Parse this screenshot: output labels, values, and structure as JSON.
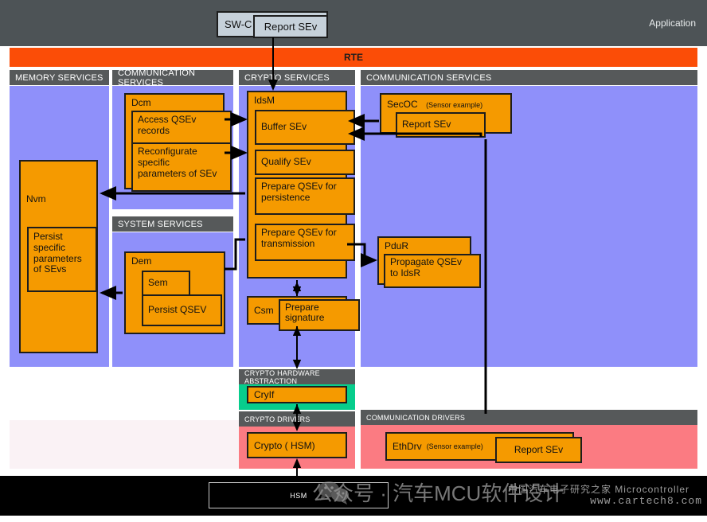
{
  "application": {
    "label": "Application",
    "swc": {
      "name": "SW-C",
      "action": "Report   SEv"
    }
  },
  "rte": {
    "label": "RTE"
  },
  "layers": {
    "memory_services": "MEMORY SERVICES",
    "communication_services_left": "COMMUNICATION SERVICES",
    "crypto_services": "CRYPTO SERVICES",
    "communication_services_right": "COMMUNICATION SERVICES",
    "system_services": "SYSTEM SERVICES",
    "crypto_hardware_abstraction": "CRYPTO  HARDWARE ABSTRACTION",
    "crypto_drivers": "CRYPTO  DRIVERS",
    "communication_drivers": "COMMUNICATION DRIVERS"
  },
  "modules": {
    "nvm": {
      "title": "Nvm",
      "items": [
        "Persist\nspecific\nparameters\nof  SEvs"
      ]
    },
    "dcm": {
      "title": "Dcm",
      "items": [
        "Access   QSEv\nrecords",
        "Reconfigurate\nspecific\nparameters of     SEv"
      ]
    },
    "dem": {
      "title": "Dem",
      "items": [
        "Sem",
        "Persist   QSEV"
      ]
    },
    "idsm": {
      "title": "IdsM",
      "items": [
        "Buffer   SEv",
        "Qualify    SEv",
        "Prepare   QSEv for\npersistence",
        "Prepare   QSEv for\ntransmission"
      ]
    },
    "csm": {
      "title": "Csm",
      "items": [
        "Prepare\nsignature"
      ]
    },
    "secoc": {
      "title": "SecOC",
      "note": "(Sensor example)",
      "items": [
        "Report   SEv"
      ]
    },
    "pdur": {
      "title": "PduR",
      "items": [
        "Propagate    QSEv\nto  IdsR"
      ]
    },
    "cryif": {
      "title": "CryIf"
    },
    "crypto": {
      "title": "Crypto (   HSM)"
    },
    "ethdrv": {
      "title": "EthDrv",
      "note": "(Sensor example)",
      "items": [
        "Report   SEv"
      ]
    }
  },
  "hsm": {
    "label": "HSM"
  },
  "watermark": {
    "main": "公众号 · 汽车MCU软件设计",
    "site": "www.cartech8.com",
    "site2": "中国汽车电子研究之家 Microcontroller"
  },
  "colors": {
    "rte": "#fb4d07",
    "bsw_panel": "#8f90fa",
    "module": "#f59a00",
    "header_bar": "#56595a",
    "hw_abstraction": "#07cd8c",
    "drivers": "#fb7b82",
    "application_strip": "#4d5356"
  }
}
